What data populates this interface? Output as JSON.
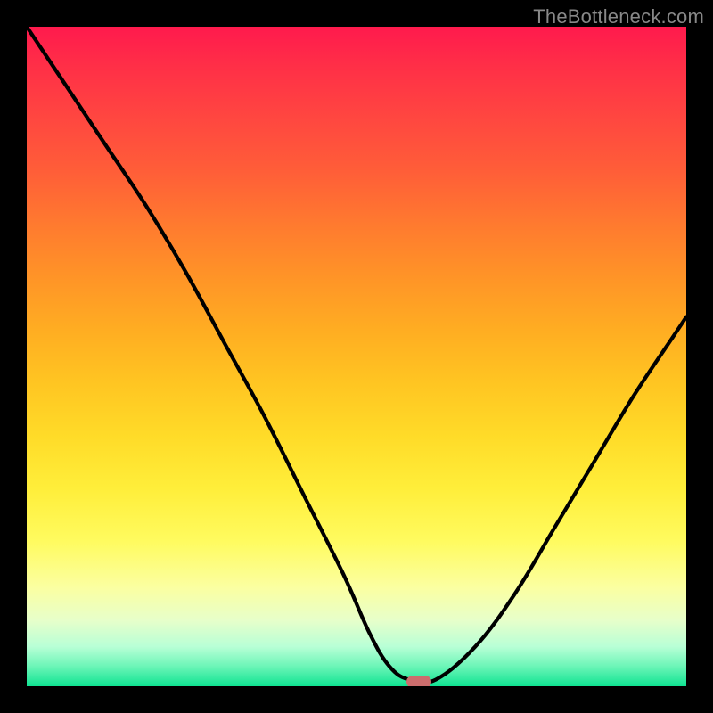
{
  "branding": "TheBottleneck.com",
  "colors": {
    "page_bg": "#000000",
    "curve": "#000000",
    "marker": "#cc6d6d",
    "gradient_top": "#ff1a4d",
    "gradient_bottom": "#10e392"
  },
  "chart_data": {
    "type": "line",
    "title": "",
    "xlabel": "",
    "ylabel": "",
    "xlim": [
      0,
      100
    ],
    "ylim": [
      0,
      100
    ],
    "grid": false,
    "series": [
      {
        "name": "bottleneck-curve",
        "x": [
          0,
          6,
          12,
          18,
          24,
          30,
          36,
          42,
          48,
          52,
          55,
          58,
          62,
          68,
          74,
          80,
          86,
          92,
          98,
          100
        ],
        "y": [
          100,
          91,
          82,
          73,
          63,
          52,
          41,
          29,
          17,
          8,
          3,
          1,
          1,
          6,
          14,
          24,
          34,
          44,
          53,
          56
        ]
      }
    ],
    "marker": {
      "x": 59.5,
      "y": 0.7
    },
    "annotations": []
  }
}
